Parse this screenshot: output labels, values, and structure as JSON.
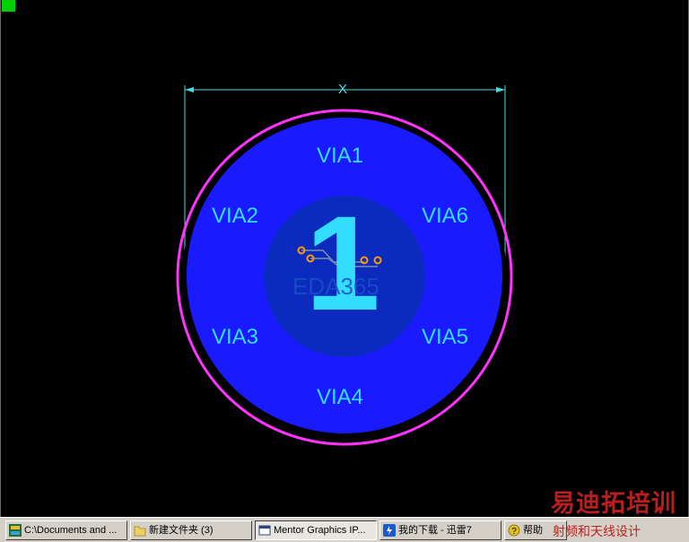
{
  "board": {
    "dimension_label": "X",
    "vias": [
      "VIA1",
      "VIA2",
      "VIA3",
      "VIA4",
      "VIA5",
      "VIA6"
    ],
    "center_number": "1",
    "watermark": "EDA365",
    "colors": {
      "background": "#000000",
      "outer_ring": "#ff33ff",
      "plane_fill": "#1a1aff",
      "inner_disk": "#0b2bbf",
      "label": "#33ddff",
      "dimension": "#44dddd",
      "pads": "#ff9900"
    }
  },
  "taskbar": {
    "items": [
      {
        "label": "C:\\Documents and ...",
        "icon": "pads-icon",
        "active": false
      },
      {
        "label": "新建文件夹 (3)",
        "icon": "folder-icon",
        "active": false
      },
      {
        "label": "Mentor Graphics IP...",
        "icon": "window-icon",
        "active": true
      },
      {
        "label": "我的下载 - 迅雷7",
        "icon": "thunder-icon",
        "active": false
      },
      {
        "label": "帮助",
        "icon": "help-icon",
        "active": false
      }
    ]
  },
  "branding": {
    "title": "易迪拓培训",
    "subtitle": "射频和天线设计"
  }
}
